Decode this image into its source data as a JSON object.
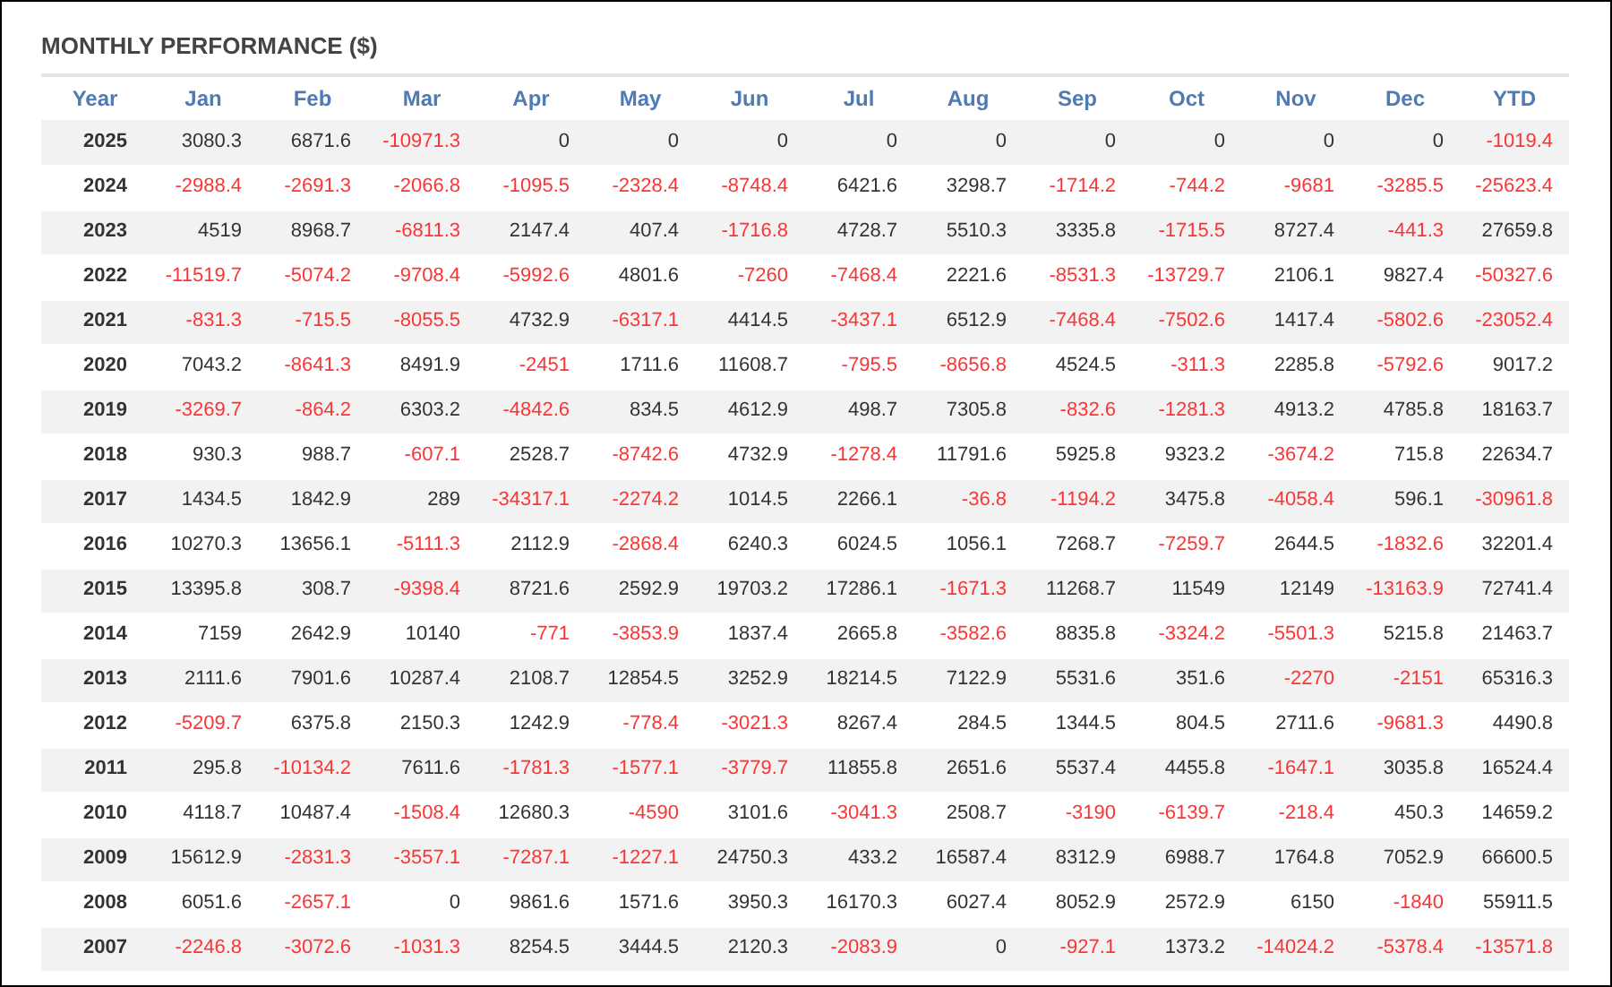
{
  "title": "MONTHLY PERFORMANCE ($)",
  "columns": [
    "Year",
    "Jan",
    "Feb",
    "Mar",
    "Apr",
    "May",
    "Jun",
    "Jul",
    "Aug",
    "Sep",
    "Oct",
    "Nov",
    "Dec",
    "YTD"
  ],
  "rows": [
    {
      "year": "2025",
      "cells": [
        {
          "value": "3080.3",
          "negative": false
        },
        {
          "value": "6871.6",
          "negative": false
        },
        {
          "value": "-10971.3",
          "negative": true
        },
        {
          "value": "0",
          "negative": false
        },
        {
          "value": "0",
          "negative": false
        },
        {
          "value": "0",
          "negative": false
        },
        {
          "value": "0",
          "negative": false
        },
        {
          "value": "0",
          "negative": false
        },
        {
          "value": "0",
          "negative": false
        },
        {
          "value": "0",
          "negative": false
        },
        {
          "value": "0",
          "negative": false
        },
        {
          "value": "0",
          "negative": false
        },
        {
          "value": "-1019.4",
          "negative": true
        }
      ]
    },
    {
      "year": "2024",
      "cells": [
        {
          "value": "-2988.4",
          "negative": true
        },
        {
          "value": "-2691.3",
          "negative": true
        },
        {
          "value": "-2066.8",
          "negative": true
        },
        {
          "value": "-1095.5",
          "negative": true
        },
        {
          "value": "-2328.4",
          "negative": true
        },
        {
          "value": "-8748.4",
          "negative": true
        },
        {
          "value": "6421.6",
          "negative": false
        },
        {
          "value": "3298.7",
          "negative": false
        },
        {
          "value": "-1714.2",
          "negative": true
        },
        {
          "value": "-744.2",
          "negative": true
        },
        {
          "value": "-9681",
          "negative": true
        },
        {
          "value": "-3285.5",
          "negative": true
        },
        {
          "value": "-25623.4",
          "negative": true
        }
      ]
    },
    {
      "year": "2023",
      "cells": [
        {
          "value": "4519",
          "negative": false
        },
        {
          "value": "8968.7",
          "negative": false
        },
        {
          "value": "-6811.3",
          "negative": true
        },
        {
          "value": "2147.4",
          "negative": false
        },
        {
          "value": "407.4",
          "negative": false
        },
        {
          "value": "-1716.8",
          "negative": true
        },
        {
          "value": "4728.7",
          "negative": false
        },
        {
          "value": "5510.3",
          "negative": false
        },
        {
          "value": "3335.8",
          "negative": false
        },
        {
          "value": "-1715.5",
          "negative": true
        },
        {
          "value": "8727.4",
          "negative": false
        },
        {
          "value": "-441.3",
          "negative": true
        },
        {
          "value": "27659.8",
          "negative": false
        }
      ]
    },
    {
      "year": "2022",
      "cells": [
        {
          "value": "-11519.7",
          "negative": true
        },
        {
          "value": "-5074.2",
          "negative": true
        },
        {
          "value": "-9708.4",
          "negative": true
        },
        {
          "value": "-5992.6",
          "negative": true
        },
        {
          "value": "4801.6",
          "negative": false
        },
        {
          "value": "-7260",
          "negative": true
        },
        {
          "value": "-7468.4",
          "negative": true
        },
        {
          "value": "2221.6",
          "negative": false
        },
        {
          "value": "-8531.3",
          "negative": true
        },
        {
          "value": "-13729.7",
          "negative": true
        },
        {
          "value": "2106.1",
          "negative": false
        },
        {
          "value": "9827.4",
          "negative": false
        },
        {
          "value": "-50327.6",
          "negative": true
        }
      ]
    },
    {
      "year": "2021",
      "cells": [
        {
          "value": "-831.3",
          "negative": true
        },
        {
          "value": "-715.5",
          "negative": true
        },
        {
          "value": "-8055.5",
          "negative": true
        },
        {
          "value": "4732.9",
          "negative": false
        },
        {
          "value": "-6317.1",
          "negative": true
        },
        {
          "value": "4414.5",
          "negative": false
        },
        {
          "value": "-3437.1",
          "negative": true
        },
        {
          "value": "6512.9",
          "negative": false
        },
        {
          "value": "-7468.4",
          "negative": true
        },
        {
          "value": "-7502.6",
          "negative": true
        },
        {
          "value": "1417.4",
          "negative": false
        },
        {
          "value": "-5802.6",
          "negative": true
        },
        {
          "value": "-23052.4",
          "negative": true
        }
      ]
    },
    {
      "year": "2020",
      "cells": [
        {
          "value": "7043.2",
          "negative": false
        },
        {
          "value": "-8641.3",
          "negative": true
        },
        {
          "value": "8491.9",
          "negative": false
        },
        {
          "value": "-2451",
          "negative": true
        },
        {
          "value": "1711.6",
          "negative": false
        },
        {
          "value": "11608.7",
          "negative": false
        },
        {
          "value": "-795.5",
          "negative": true
        },
        {
          "value": "-8656.8",
          "negative": true
        },
        {
          "value": "4524.5",
          "negative": false
        },
        {
          "value": "-311.3",
          "negative": true
        },
        {
          "value": "2285.8",
          "negative": false
        },
        {
          "value": "-5792.6",
          "negative": true
        },
        {
          "value": "9017.2",
          "negative": false
        }
      ]
    },
    {
      "year": "2019",
      "cells": [
        {
          "value": "-3269.7",
          "negative": true
        },
        {
          "value": "-864.2",
          "negative": true
        },
        {
          "value": "6303.2",
          "negative": false
        },
        {
          "value": "-4842.6",
          "negative": true
        },
        {
          "value": "834.5",
          "negative": false
        },
        {
          "value": "4612.9",
          "negative": false
        },
        {
          "value": "498.7",
          "negative": false
        },
        {
          "value": "7305.8",
          "negative": false
        },
        {
          "value": "-832.6",
          "negative": true
        },
        {
          "value": "-1281.3",
          "negative": true
        },
        {
          "value": "4913.2",
          "negative": false
        },
        {
          "value": "4785.8",
          "negative": false
        },
        {
          "value": "18163.7",
          "negative": false
        }
      ]
    },
    {
      "year": "2018",
      "cells": [
        {
          "value": "930.3",
          "negative": false
        },
        {
          "value": "988.7",
          "negative": false
        },
        {
          "value": "-607.1",
          "negative": true
        },
        {
          "value": "2528.7",
          "negative": false
        },
        {
          "value": "-8742.6",
          "negative": true
        },
        {
          "value": "4732.9",
          "negative": false
        },
        {
          "value": "-1278.4",
          "negative": true
        },
        {
          "value": "11791.6",
          "negative": false
        },
        {
          "value": "5925.8",
          "negative": false
        },
        {
          "value": "9323.2",
          "negative": false
        },
        {
          "value": "-3674.2",
          "negative": true
        },
        {
          "value": "715.8",
          "negative": false
        },
        {
          "value": "22634.7",
          "negative": false
        }
      ]
    },
    {
      "year": "2017",
      "cells": [
        {
          "value": "1434.5",
          "negative": false
        },
        {
          "value": "1842.9",
          "negative": false
        },
        {
          "value": "289",
          "negative": false
        },
        {
          "value": "-34317.1",
          "negative": true
        },
        {
          "value": "-2274.2",
          "negative": true
        },
        {
          "value": "1014.5",
          "negative": false
        },
        {
          "value": "2266.1",
          "negative": false
        },
        {
          "value": "-36.8",
          "negative": true
        },
        {
          "value": "-1194.2",
          "negative": true
        },
        {
          "value": "3475.8",
          "negative": false
        },
        {
          "value": "-4058.4",
          "negative": true
        },
        {
          "value": "596.1",
          "negative": false
        },
        {
          "value": "-30961.8",
          "negative": true
        }
      ]
    },
    {
      "year": "2016",
      "cells": [
        {
          "value": "10270.3",
          "negative": false
        },
        {
          "value": "13656.1",
          "negative": false
        },
        {
          "value": "-5111.3",
          "negative": true
        },
        {
          "value": "2112.9",
          "negative": false
        },
        {
          "value": "-2868.4",
          "negative": true
        },
        {
          "value": "6240.3",
          "negative": false
        },
        {
          "value": "6024.5",
          "negative": false
        },
        {
          "value": "1056.1",
          "negative": false
        },
        {
          "value": "7268.7",
          "negative": false
        },
        {
          "value": "-7259.7",
          "negative": true
        },
        {
          "value": "2644.5",
          "negative": false
        },
        {
          "value": "-1832.6",
          "negative": true
        },
        {
          "value": "32201.4",
          "negative": false
        }
      ]
    },
    {
      "year": "2015",
      "cells": [
        {
          "value": "13395.8",
          "negative": false
        },
        {
          "value": "308.7",
          "negative": false
        },
        {
          "value": "-9398.4",
          "negative": true
        },
        {
          "value": "8721.6",
          "negative": false
        },
        {
          "value": "2592.9",
          "negative": false
        },
        {
          "value": "19703.2",
          "negative": false
        },
        {
          "value": "17286.1",
          "negative": false
        },
        {
          "value": "-1671.3",
          "negative": true
        },
        {
          "value": "11268.7",
          "negative": false
        },
        {
          "value": "11549",
          "negative": false
        },
        {
          "value": "12149",
          "negative": false
        },
        {
          "value": "-13163.9",
          "negative": true
        },
        {
          "value": "72741.4",
          "negative": false
        }
      ]
    },
    {
      "year": "2014",
      "cells": [
        {
          "value": "7159",
          "negative": false
        },
        {
          "value": "2642.9",
          "negative": false
        },
        {
          "value": "10140",
          "negative": false
        },
        {
          "value": "-771",
          "negative": true
        },
        {
          "value": "-3853.9",
          "negative": true
        },
        {
          "value": "1837.4",
          "negative": false
        },
        {
          "value": "2665.8",
          "negative": false
        },
        {
          "value": "-3582.6",
          "negative": true
        },
        {
          "value": "8835.8",
          "negative": false
        },
        {
          "value": "-3324.2",
          "negative": true
        },
        {
          "value": "-5501.3",
          "negative": true
        },
        {
          "value": "5215.8",
          "negative": false
        },
        {
          "value": "21463.7",
          "negative": false
        }
      ]
    },
    {
      "year": "2013",
      "cells": [
        {
          "value": "2111.6",
          "negative": false
        },
        {
          "value": "7901.6",
          "negative": false
        },
        {
          "value": "10287.4",
          "negative": false
        },
        {
          "value": "2108.7",
          "negative": false
        },
        {
          "value": "12854.5",
          "negative": false
        },
        {
          "value": "3252.9",
          "negative": false
        },
        {
          "value": "18214.5",
          "negative": false
        },
        {
          "value": "7122.9",
          "negative": false
        },
        {
          "value": "5531.6",
          "negative": false
        },
        {
          "value": "351.6",
          "negative": false
        },
        {
          "value": "-2270",
          "negative": true
        },
        {
          "value": "-2151",
          "negative": true
        },
        {
          "value": "65316.3",
          "negative": false
        }
      ]
    },
    {
      "year": "2012",
      "cells": [
        {
          "value": "-5209.7",
          "negative": true
        },
        {
          "value": "6375.8",
          "negative": false
        },
        {
          "value": "2150.3",
          "negative": false
        },
        {
          "value": "1242.9",
          "negative": false
        },
        {
          "value": "-778.4",
          "negative": true
        },
        {
          "value": "-3021.3",
          "negative": true
        },
        {
          "value": "8267.4",
          "negative": false
        },
        {
          "value": "284.5",
          "negative": false
        },
        {
          "value": "1344.5",
          "negative": false
        },
        {
          "value": "804.5",
          "negative": false
        },
        {
          "value": "2711.6",
          "negative": false
        },
        {
          "value": "-9681.3",
          "negative": true
        },
        {
          "value": "4490.8",
          "negative": false
        }
      ]
    },
    {
      "year": "2011",
      "cells": [
        {
          "value": "295.8",
          "negative": false
        },
        {
          "value": "-10134.2",
          "negative": true
        },
        {
          "value": "7611.6",
          "negative": false
        },
        {
          "value": "-1781.3",
          "negative": true
        },
        {
          "value": "-1577.1",
          "negative": true
        },
        {
          "value": "-3779.7",
          "negative": true
        },
        {
          "value": "11855.8",
          "negative": false
        },
        {
          "value": "2651.6",
          "negative": false
        },
        {
          "value": "5537.4",
          "negative": false
        },
        {
          "value": "4455.8",
          "negative": false
        },
        {
          "value": "-1647.1",
          "negative": true
        },
        {
          "value": "3035.8",
          "negative": false
        },
        {
          "value": "16524.4",
          "negative": false
        }
      ]
    },
    {
      "year": "2010",
      "cells": [
        {
          "value": "4118.7",
          "negative": false
        },
        {
          "value": "10487.4",
          "negative": false
        },
        {
          "value": "-1508.4",
          "negative": true
        },
        {
          "value": "12680.3",
          "negative": false
        },
        {
          "value": "-4590",
          "negative": true
        },
        {
          "value": "3101.6",
          "negative": false
        },
        {
          "value": "-3041.3",
          "negative": true
        },
        {
          "value": "2508.7",
          "negative": false
        },
        {
          "value": "-3190",
          "negative": true
        },
        {
          "value": "-6139.7",
          "negative": true
        },
        {
          "value": "-218.4",
          "negative": true
        },
        {
          "value": "450.3",
          "negative": false
        },
        {
          "value": "14659.2",
          "negative": false
        }
      ]
    },
    {
      "year": "2009",
      "cells": [
        {
          "value": "15612.9",
          "negative": false
        },
        {
          "value": "-2831.3",
          "negative": true
        },
        {
          "value": "-3557.1",
          "negative": true
        },
        {
          "value": "-7287.1",
          "negative": true
        },
        {
          "value": "-1227.1",
          "negative": true
        },
        {
          "value": "24750.3",
          "negative": false
        },
        {
          "value": "433.2",
          "negative": false
        },
        {
          "value": "16587.4",
          "negative": false
        },
        {
          "value": "8312.9",
          "negative": false
        },
        {
          "value": "6988.7",
          "negative": false
        },
        {
          "value": "1764.8",
          "negative": false
        },
        {
          "value": "7052.9",
          "negative": false
        },
        {
          "value": "66600.5",
          "negative": false
        }
      ]
    },
    {
      "year": "2008",
      "cells": [
        {
          "value": "6051.6",
          "negative": false
        },
        {
          "value": "-2657.1",
          "negative": true
        },
        {
          "value": "0",
          "negative": false
        },
        {
          "value": "9861.6",
          "negative": false
        },
        {
          "value": "1571.6",
          "negative": false
        },
        {
          "value": "3950.3",
          "negative": false
        },
        {
          "value": "16170.3",
          "negative": false
        },
        {
          "value": "6027.4",
          "negative": false
        },
        {
          "value": "8052.9",
          "negative": false
        },
        {
          "value": "2572.9",
          "negative": false
        },
        {
          "value": "6150",
          "negative": false
        },
        {
          "value": "-1840",
          "negative": true
        },
        {
          "value": "55911.5",
          "negative": false
        }
      ]
    },
    {
      "year": "2007",
      "cells": [
        {
          "value": "-2246.8",
          "negative": true
        },
        {
          "value": "-3072.6",
          "negative": true
        },
        {
          "value": "-1031.3",
          "negative": true
        },
        {
          "value": "8254.5",
          "negative": false
        },
        {
          "value": "3444.5",
          "negative": false
        },
        {
          "value": "2120.3",
          "negative": false
        },
        {
          "value": "-2083.9",
          "negative": true
        },
        {
          "value": "0",
          "negative": false
        },
        {
          "value": "-927.1",
          "negative": true
        },
        {
          "value": "1373.2",
          "negative": false
        },
        {
          "value": "-14024.2",
          "negative": true
        },
        {
          "value": "-5378.4",
          "negative": true
        },
        {
          "value": "-13571.8",
          "negative": true
        }
      ]
    }
  ]
}
